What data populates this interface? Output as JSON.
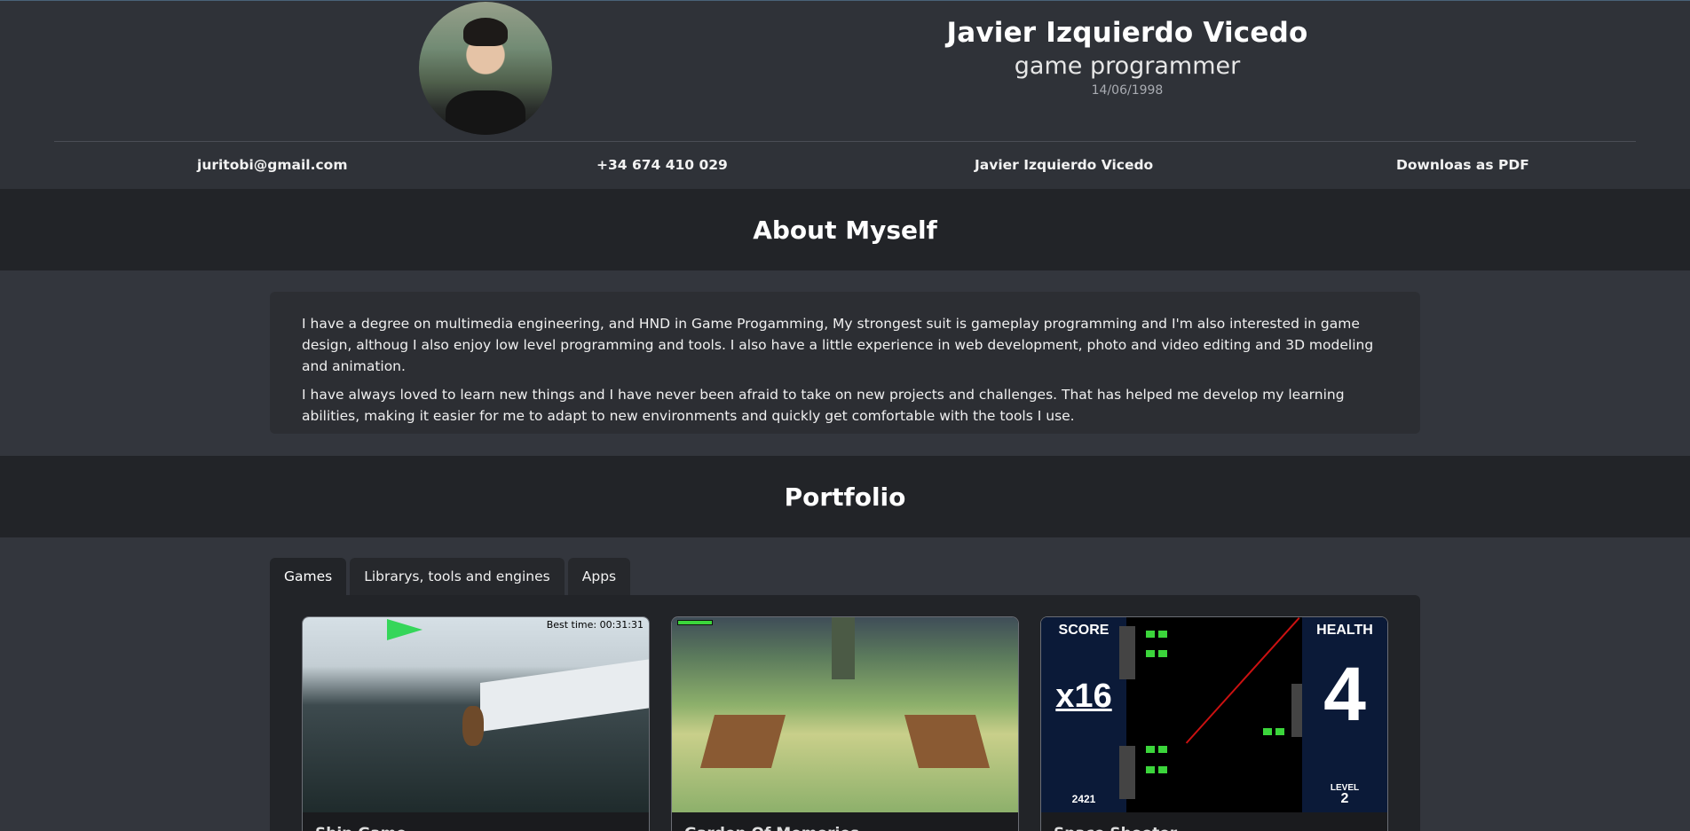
{
  "header": {
    "name": "Javier Izquierdo Vicedo",
    "role": "game programmer",
    "birthdate": "14/06/1998"
  },
  "contacts": {
    "email": "juritobi@gmail.com",
    "phone": "+34 674 410 029",
    "linkedin": "Javier Izquierdo Vicedo",
    "pdf": "Downloas as PDF"
  },
  "about": {
    "title": "About Myself",
    "paragraphs": [
      "I have a degree on multimedia engineering, and HND in Game Progamming, My strongest suit is gameplay programming and I'm also interested in game design, althoug I also enjoy low level programming and tools. I also have a little experience in web development, photo and video editing and 3D modeling and animation.",
      "I have always loved to learn new things and I have never been afraid to take on new projects and challenges. That has helped me develop my learning abilities, making it easier for me to adapt to new environments and quickly get comfortable with the tools I use."
    ]
  },
  "portfolio": {
    "title": "Portfolio",
    "tabs": [
      "Games",
      "Librarys, tools and engines",
      "Apps"
    ],
    "cards": [
      {
        "caption": "Ship Game",
        "best_time": "Best time: 00:31:31"
      },
      {
        "caption": "Garden Of Memories",
        "hud": ""
      },
      {
        "caption": "Space Shooter",
        "score_label": "SCORE",
        "multiplier": "x16",
        "score_value": "2421",
        "health_label": "HEALTH",
        "health_value": "4",
        "level_label": "LEVEL",
        "level_value": "2"
      }
    ]
  },
  "colors": {
    "page_bg": "#33363d",
    "band_bg": "#222428",
    "card_bg": "#2c2e33"
  }
}
